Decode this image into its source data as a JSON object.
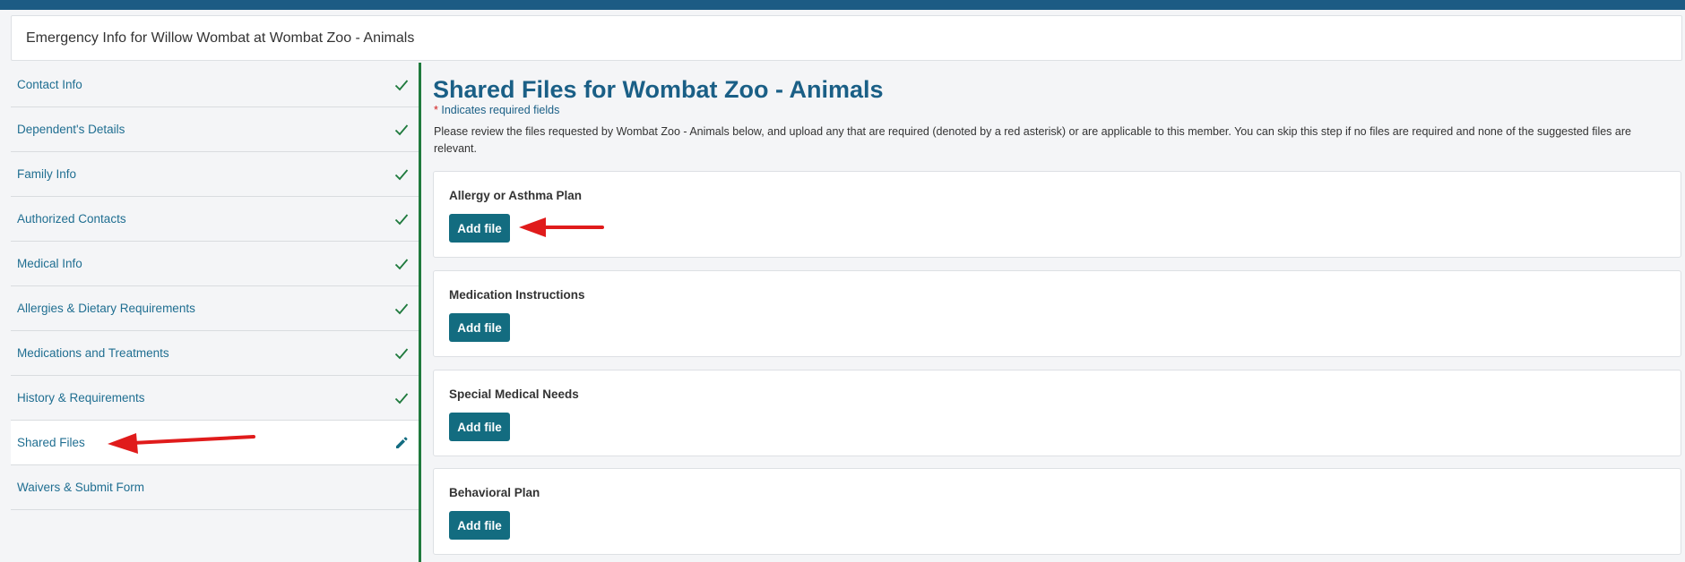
{
  "header": {
    "title": "Emergency Info for Willow Wombat at Wombat Zoo - Animals"
  },
  "sidebar": {
    "items": [
      {
        "label": "Contact Info",
        "status": "check-icon"
      },
      {
        "label": "Dependent's Details",
        "status": "check-icon"
      },
      {
        "label": "Family Info",
        "status": "check-icon"
      },
      {
        "label": "Authorized Contacts",
        "status": "check-icon"
      },
      {
        "label": "Medical Info",
        "status": "check-icon"
      },
      {
        "label": "Allergies & Dietary Requirements",
        "status": "check-icon"
      },
      {
        "label": "Medications and Treatments",
        "status": "check-icon"
      },
      {
        "label": "History & Requirements",
        "status": "check-icon"
      },
      {
        "label": "Shared Files",
        "status": "pencil-icon",
        "active": true
      },
      {
        "label": "Waivers & Submit Form",
        "status": ""
      }
    ]
  },
  "main": {
    "title": "Shared Files for Wombat Zoo - Animals",
    "required_star": "*",
    "required_note": " Indicates required fields",
    "intro": "Please review the files requested by Wombat Zoo - Animals below, and upload any that are required (denoted by a red asterisk) or are applicable to this member. You can skip this step if no files are required and none of the suggested files are relevant.",
    "cards": [
      {
        "label": "Allergy or Asthma Plan",
        "button": "Add file"
      },
      {
        "label": "Medication Instructions",
        "button": "Add file"
      },
      {
        "label": "Special Medical Needs",
        "button": "Add file"
      },
      {
        "label": "Behavioral Plan",
        "button": "Add file"
      }
    ]
  },
  "colors": {
    "brand": "#1c5b84",
    "title": "#1a5f86",
    "button": "#136c80",
    "check": "#1f7a3d",
    "arrow": "#e01b1b"
  }
}
